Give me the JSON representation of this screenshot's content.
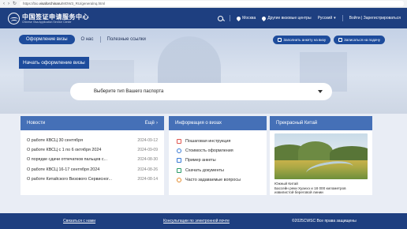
{
  "browser": {
    "url_prefix": "https://bio.",
    "url_domain": "visaforchinaru",
    "url_path": "/MOW3_RU/generalnq.html"
  },
  "header": {
    "logo_cn": "中国签证申请服务中心",
    "logo_en": "Chinese Visa Application Service Center",
    "city": "Москва",
    "centers": "Другие визовые центры",
    "language": "Русский",
    "login": "Войти | Зарегистрироваться"
  },
  "hero": {
    "tabs": [
      "Оформление визы",
      "О нас",
      "Полезные ссылки"
    ],
    "btn_apply": "Заполнить анкету на визу",
    "btn_appointment": "Записаться на подачу",
    "start_title": "Начать оформление визы",
    "passport_select": "Выберите тип Вашего паспорта"
  },
  "news": {
    "title": "Новости",
    "more": "Ещё",
    "items": [
      {
        "text": "О работе КВСЦ 30 сентября",
        "date": "2024-09-12"
      },
      {
        "text": "О работе КВСЦ с 1 по 6 октября 2024",
        "date": "2024-09-09"
      },
      {
        "text": "О порядке сдачи отпечатков пальцев с...",
        "date": "2024-08-30"
      },
      {
        "text": "О работе КВСЦ 16-17 сентября 2024",
        "date": "2024-08-26"
      },
      {
        "text": "О работе Китайского Визового Сервисног...",
        "date": "2024-08-14"
      }
    ]
  },
  "info": {
    "title": "Информация о визах",
    "items": [
      {
        "label": "Пошаговая инструкция",
        "color": "#e0564f"
      },
      {
        "label": "Стоимость оформления",
        "color": "#3a7bd5"
      },
      {
        "label": "Пример анкеты",
        "color": "#3a7bd5"
      },
      {
        "label": "Скачать документы",
        "color": "#2c9c6a"
      },
      {
        "label": "Часто задаваемые вопросы",
        "color": "#e28a2b"
      }
    ]
  },
  "china": {
    "title": "Прекрасный Китай",
    "caption_1": "Южный Китай",
    "caption_2": "Бассейн реки Хуанхэ и 18 000 километров",
    "caption_3": "извилистой береговой линии"
  },
  "footer": {
    "contact": "Связаться с нами",
    "consult": "Консультации по электронной почте",
    "copyright": "©2025CWSC Все права защищены"
  }
}
